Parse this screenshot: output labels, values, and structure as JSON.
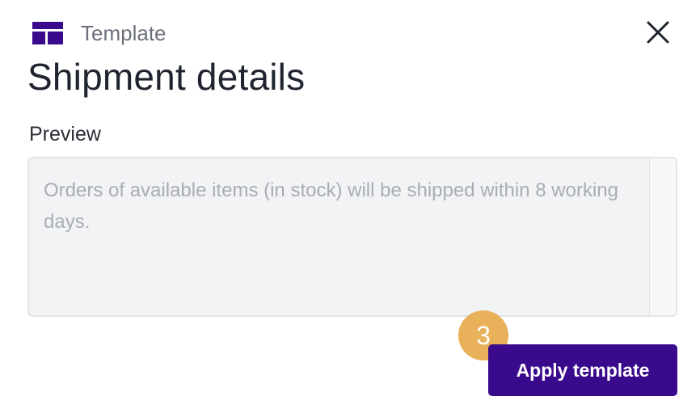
{
  "header": {
    "icon": "template-layout-icon",
    "label": "Template",
    "close_icon": "close-icon"
  },
  "title": "Shipment details",
  "preview": {
    "label": "Preview",
    "text": "Orders of available items (in stock) will be shipped within 8 working days."
  },
  "step_badge": "3",
  "apply_button": {
    "label": "Apply template"
  },
  "colors": {
    "accent": "#3a0a8c",
    "badge": "#e9b25a",
    "preview_bg": "#f2f3f5",
    "muted_text": "#a9acb4"
  }
}
